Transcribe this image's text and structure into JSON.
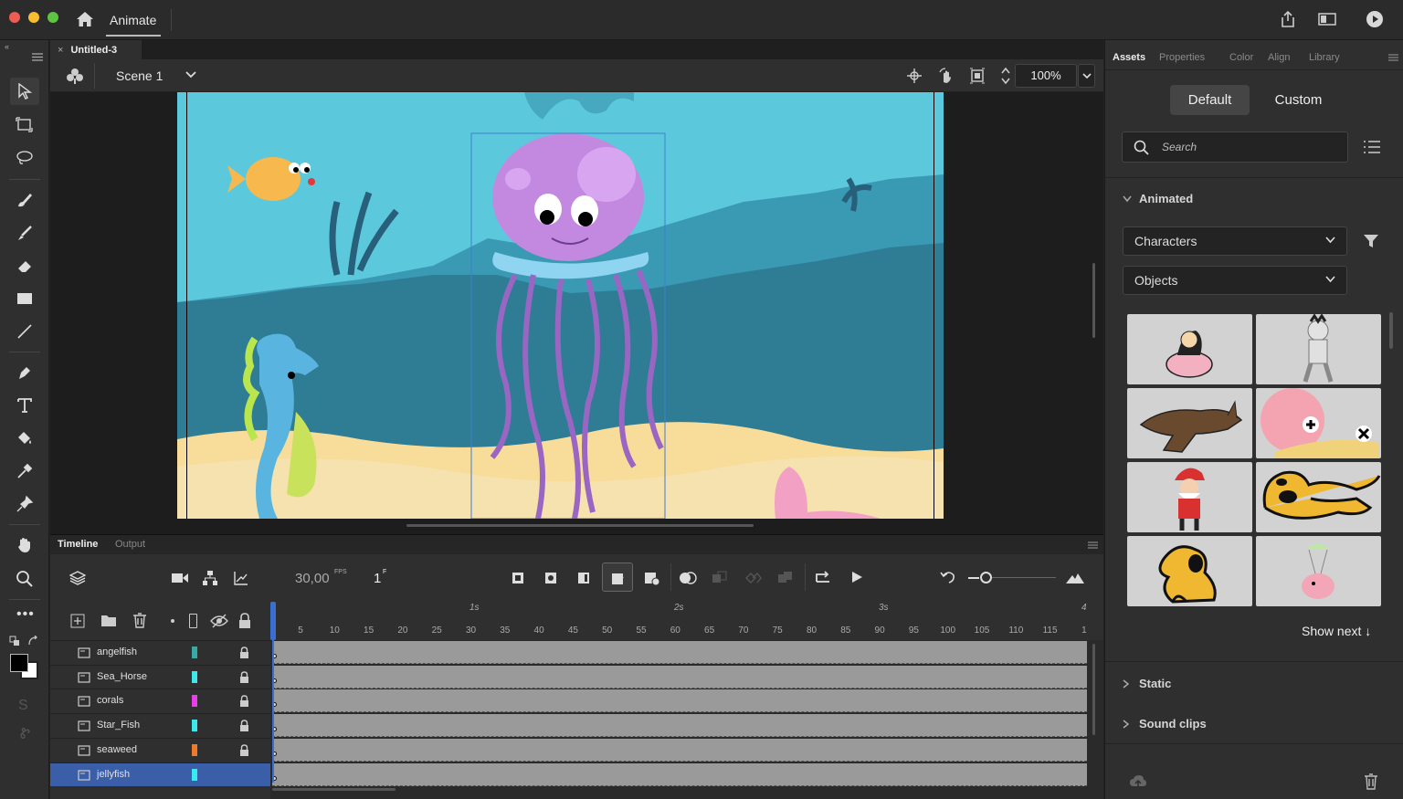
{
  "app": {
    "name": "Animate"
  },
  "document": {
    "tab_title": "Untitled-3",
    "close": "×"
  },
  "scene": {
    "name": "Scene 1",
    "zoom": "100%"
  },
  "timeline": {
    "tabs": [
      "Timeline",
      "Output"
    ],
    "fps": "30,00",
    "fps_unit": "FPS",
    "current_frame": "1",
    "frame_unit": "F",
    "seconds_marks": [
      "1s",
      "2s",
      "3s",
      "4"
    ],
    "frame_numbers": [
      "5",
      "10",
      "15",
      "20",
      "25",
      "30",
      "35",
      "40",
      "45",
      "50",
      "55",
      "60",
      "65",
      "70",
      "75",
      "80",
      "85",
      "90",
      "95",
      "100",
      "105",
      "110",
      "115",
      "1"
    ],
    "layers": [
      {
        "name": "angelfish",
        "color": "#3aa9a5",
        "locked": true,
        "selected": false
      },
      {
        "name": "Sea_Horse",
        "color": "#3ee8e8",
        "locked": true,
        "selected": false
      },
      {
        "name": "corals",
        "color": "#e83ee8",
        "locked": true,
        "selected": false
      },
      {
        "name": "Star_Fish",
        "color": "#3ee8e8",
        "locked": true,
        "selected": false
      },
      {
        "name": "seaweed",
        "color": "#f07a2a",
        "locked": true,
        "selected": false
      },
      {
        "name": "jellyfish",
        "color": "#3ee8f0",
        "locked": false,
        "selected": true
      }
    ]
  },
  "assets_panel": {
    "tabs": [
      "Assets",
      "Properties",
      "Color",
      "Align",
      "Library"
    ],
    "active_tab": "Assets",
    "segments": [
      "Default",
      "Custom"
    ],
    "search_placeholder": "Search",
    "animated_label": "Animated",
    "filter1": "Characters",
    "filter2": "Objects",
    "show_next": "Show next ↓",
    "static_label": "Static",
    "sound_label": "Sound clips"
  },
  "colors": {
    "accent": "#3b5ea8",
    "stroke": "#000000",
    "fill": "#ffffff"
  }
}
